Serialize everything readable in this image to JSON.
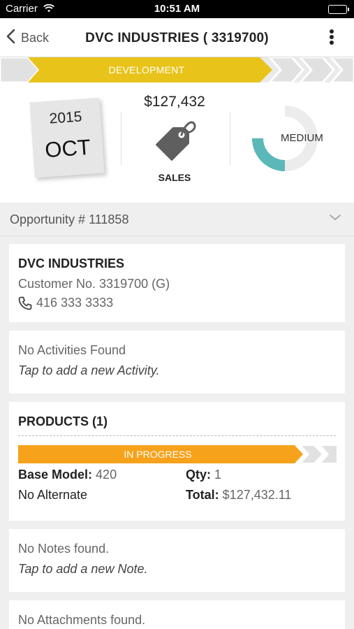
{
  "status_bar": {
    "carrier": "Carrier",
    "time": "10:51 AM"
  },
  "nav": {
    "back_label": "Back",
    "title": "DVC INDUSTRIES ( 3319700)"
  },
  "stage": {
    "label": "DEVELOPMENT",
    "color": "#e8c31a"
  },
  "summary": {
    "year": "2015",
    "month": "OCT",
    "sales_amount": "$127,432",
    "sales_label": "SALES",
    "probability_label": "MEDIUM",
    "probability_color": "#5cb8b8"
  },
  "opportunity": {
    "label": "Opportunity # 111858"
  },
  "customer": {
    "name": "DVC INDUSTRIES",
    "customer_no": "Customer No. 3319700 (G)",
    "phone": "416 333 3333"
  },
  "activities": {
    "empty_text": "No Activities Found",
    "add_text": "Tap to add a new Activity."
  },
  "products": {
    "title": "PRODUCTS (1)",
    "stage_label": "IN PROGRESS",
    "stage_color": "#f6a21a",
    "base_model_label": "Base Model:",
    "base_model_value": "420",
    "qty_label": "Qty:",
    "qty_value": "1",
    "alternate_label": "No Alternate",
    "total_label": "Total:",
    "total_value": "$127,432.11"
  },
  "notes": {
    "empty_text": "No Notes found.",
    "add_text": "Tap to add a new Note."
  },
  "attachments": {
    "empty_text": "No Attachments found."
  }
}
